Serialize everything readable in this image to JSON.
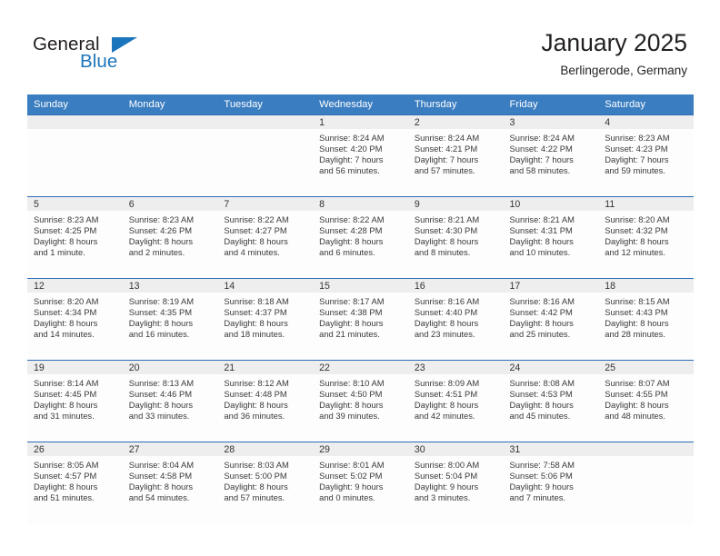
{
  "brand": {
    "name_part1": "General",
    "name_part2": "Blue",
    "accent_color": "#1b75bc",
    "logo_icon": "triangle-flag-icon"
  },
  "header": {
    "title": "January 2025",
    "subtitle": "Berlingerode, Germany"
  },
  "theme": {
    "header_row_bg": "#3a7dc0",
    "grid_line": "#2c6db5",
    "daynum_band_bg": "#eeeeee",
    "text_color": "#231f20"
  },
  "weekday_headers": [
    "Sunday",
    "Monday",
    "Tuesday",
    "Wednesday",
    "Thursday",
    "Friday",
    "Saturday"
  ],
  "weeks": [
    [
      {
        "day": "",
        "empty": true
      },
      {
        "day": "",
        "empty": true
      },
      {
        "day": "",
        "empty": true
      },
      {
        "day": "1",
        "sunrise": "Sunrise: 8:24 AM",
        "sunset": "Sunset: 4:20 PM",
        "daylight1": "Daylight: 7 hours",
        "daylight2": "and 56 minutes."
      },
      {
        "day": "2",
        "sunrise": "Sunrise: 8:24 AM",
        "sunset": "Sunset: 4:21 PM",
        "daylight1": "Daylight: 7 hours",
        "daylight2": "and 57 minutes."
      },
      {
        "day": "3",
        "sunrise": "Sunrise: 8:24 AM",
        "sunset": "Sunset: 4:22 PM",
        "daylight1": "Daylight: 7 hours",
        "daylight2": "and 58 minutes."
      },
      {
        "day": "4",
        "sunrise": "Sunrise: 8:23 AM",
        "sunset": "Sunset: 4:23 PM",
        "daylight1": "Daylight: 7 hours",
        "daylight2": "and 59 minutes."
      }
    ],
    [
      {
        "day": "5",
        "sunrise": "Sunrise: 8:23 AM",
        "sunset": "Sunset: 4:25 PM",
        "daylight1": "Daylight: 8 hours",
        "daylight2": "and 1 minute."
      },
      {
        "day": "6",
        "sunrise": "Sunrise: 8:23 AM",
        "sunset": "Sunset: 4:26 PM",
        "daylight1": "Daylight: 8 hours",
        "daylight2": "and 2 minutes."
      },
      {
        "day": "7",
        "sunrise": "Sunrise: 8:22 AM",
        "sunset": "Sunset: 4:27 PM",
        "daylight1": "Daylight: 8 hours",
        "daylight2": "and 4 minutes."
      },
      {
        "day": "8",
        "sunrise": "Sunrise: 8:22 AM",
        "sunset": "Sunset: 4:28 PM",
        "daylight1": "Daylight: 8 hours",
        "daylight2": "and 6 minutes."
      },
      {
        "day": "9",
        "sunrise": "Sunrise: 8:21 AM",
        "sunset": "Sunset: 4:30 PM",
        "daylight1": "Daylight: 8 hours",
        "daylight2": "and 8 minutes."
      },
      {
        "day": "10",
        "sunrise": "Sunrise: 8:21 AM",
        "sunset": "Sunset: 4:31 PM",
        "daylight1": "Daylight: 8 hours",
        "daylight2": "and 10 minutes."
      },
      {
        "day": "11",
        "sunrise": "Sunrise: 8:20 AM",
        "sunset": "Sunset: 4:32 PM",
        "daylight1": "Daylight: 8 hours",
        "daylight2": "and 12 minutes."
      }
    ],
    [
      {
        "day": "12",
        "sunrise": "Sunrise: 8:20 AM",
        "sunset": "Sunset: 4:34 PM",
        "daylight1": "Daylight: 8 hours",
        "daylight2": "and 14 minutes."
      },
      {
        "day": "13",
        "sunrise": "Sunrise: 8:19 AM",
        "sunset": "Sunset: 4:35 PM",
        "daylight1": "Daylight: 8 hours",
        "daylight2": "and 16 minutes."
      },
      {
        "day": "14",
        "sunrise": "Sunrise: 8:18 AM",
        "sunset": "Sunset: 4:37 PM",
        "daylight1": "Daylight: 8 hours",
        "daylight2": "and 18 minutes."
      },
      {
        "day": "15",
        "sunrise": "Sunrise: 8:17 AM",
        "sunset": "Sunset: 4:38 PM",
        "daylight1": "Daylight: 8 hours",
        "daylight2": "and 21 minutes."
      },
      {
        "day": "16",
        "sunrise": "Sunrise: 8:16 AM",
        "sunset": "Sunset: 4:40 PM",
        "daylight1": "Daylight: 8 hours",
        "daylight2": "and 23 minutes."
      },
      {
        "day": "17",
        "sunrise": "Sunrise: 8:16 AM",
        "sunset": "Sunset: 4:42 PM",
        "daylight1": "Daylight: 8 hours",
        "daylight2": "and 25 minutes."
      },
      {
        "day": "18",
        "sunrise": "Sunrise: 8:15 AM",
        "sunset": "Sunset: 4:43 PM",
        "daylight1": "Daylight: 8 hours",
        "daylight2": "and 28 minutes."
      }
    ],
    [
      {
        "day": "19",
        "sunrise": "Sunrise: 8:14 AM",
        "sunset": "Sunset: 4:45 PM",
        "daylight1": "Daylight: 8 hours",
        "daylight2": "and 31 minutes."
      },
      {
        "day": "20",
        "sunrise": "Sunrise: 8:13 AM",
        "sunset": "Sunset: 4:46 PM",
        "daylight1": "Daylight: 8 hours",
        "daylight2": "and 33 minutes."
      },
      {
        "day": "21",
        "sunrise": "Sunrise: 8:12 AM",
        "sunset": "Sunset: 4:48 PM",
        "daylight1": "Daylight: 8 hours",
        "daylight2": "and 36 minutes."
      },
      {
        "day": "22",
        "sunrise": "Sunrise: 8:10 AM",
        "sunset": "Sunset: 4:50 PM",
        "daylight1": "Daylight: 8 hours",
        "daylight2": "and 39 minutes."
      },
      {
        "day": "23",
        "sunrise": "Sunrise: 8:09 AM",
        "sunset": "Sunset: 4:51 PM",
        "daylight1": "Daylight: 8 hours",
        "daylight2": "and 42 minutes."
      },
      {
        "day": "24",
        "sunrise": "Sunrise: 8:08 AM",
        "sunset": "Sunset: 4:53 PM",
        "daylight1": "Daylight: 8 hours",
        "daylight2": "and 45 minutes."
      },
      {
        "day": "25",
        "sunrise": "Sunrise: 8:07 AM",
        "sunset": "Sunset: 4:55 PM",
        "daylight1": "Daylight: 8 hours",
        "daylight2": "and 48 minutes."
      }
    ],
    [
      {
        "day": "26",
        "sunrise": "Sunrise: 8:05 AM",
        "sunset": "Sunset: 4:57 PM",
        "daylight1": "Daylight: 8 hours",
        "daylight2": "and 51 minutes."
      },
      {
        "day": "27",
        "sunrise": "Sunrise: 8:04 AM",
        "sunset": "Sunset: 4:58 PM",
        "daylight1": "Daylight: 8 hours",
        "daylight2": "and 54 minutes."
      },
      {
        "day": "28",
        "sunrise": "Sunrise: 8:03 AM",
        "sunset": "Sunset: 5:00 PM",
        "daylight1": "Daylight: 8 hours",
        "daylight2": "and 57 minutes."
      },
      {
        "day": "29",
        "sunrise": "Sunrise: 8:01 AM",
        "sunset": "Sunset: 5:02 PM",
        "daylight1": "Daylight: 9 hours",
        "daylight2": "and 0 minutes."
      },
      {
        "day": "30",
        "sunrise": "Sunrise: 8:00 AM",
        "sunset": "Sunset: 5:04 PM",
        "daylight1": "Daylight: 9 hours",
        "daylight2": "and 3 minutes."
      },
      {
        "day": "31",
        "sunrise": "Sunrise: 7:58 AM",
        "sunset": "Sunset: 5:06 PM",
        "daylight1": "Daylight: 9 hours",
        "daylight2": "and 7 minutes."
      },
      {
        "day": "",
        "empty": true
      }
    ]
  ]
}
